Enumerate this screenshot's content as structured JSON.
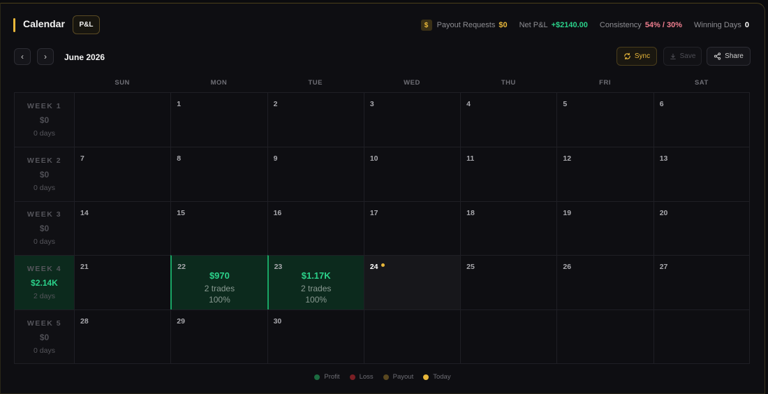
{
  "header": {
    "title": "Calendar",
    "pl_button": "P&L",
    "payout_icon": "$",
    "stats": [
      {
        "label": "Payout Requests",
        "value": "$0",
        "color": "#e8b73a"
      },
      {
        "label": "Net P&L",
        "value": "+$2140.00",
        "color": "#2bd18a"
      },
      {
        "label": "Consistency",
        "value": "54% / 30%",
        "color": "#f07f8f"
      },
      {
        "label": "Winning Days",
        "value": "0",
        "color": "#ffffff"
      }
    ]
  },
  "toolbar": {
    "prev_icon": "‹",
    "next_icon": "›",
    "month": "June 2026",
    "sync_label": "Sync",
    "save_label": "Save",
    "share_label": "Share"
  },
  "weekdays": [
    "SUN",
    "MON",
    "TUE",
    "WED",
    "THU",
    "FRI",
    "SAT"
  ],
  "weeks": [
    {
      "label": "WEEK 1",
      "amount": "$0",
      "days": "0 days",
      "active": false,
      "cells": [
        {
          "day": ""
        },
        {
          "day": "1"
        },
        {
          "day": "2"
        },
        {
          "day": "3"
        },
        {
          "day": "4"
        },
        {
          "day": "5"
        },
        {
          "day": "6"
        }
      ]
    },
    {
      "label": "WEEK 2",
      "amount": "$0",
      "days": "0 days",
      "active": false,
      "cells": [
        {
          "day": "7"
        },
        {
          "day": "8"
        },
        {
          "day": "9"
        },
        {
          "day": "10"
        },
        {
          "day": "11"
        },
        {
          "day": "12"
        },
        {
          "day": "13"
        }
      ]
    },
    {
      "label": "WEEK 3",
      "amount": "$0",
      "days": "0 days",
      "active": false,
      "cells": [
        {
          "day": "14"
        },
        {
          "day": "15"
        },
        {
          "day": "16"
        },
        {
          "day": "17"
        },
        {
          "day": "18"
        },
        {
          "day": "19"
        },
        {
          "day": "20"
        }
      ]
    },
    {
      "label": "WEEK 4",
      "amount": "$2.14K",
      "days": "2 days",
      "active": true,
      "cells": [
        {
          "day": "21"
        },
        {
          "day": "22",
          "amount": "$970",
          "trades": "2 trades",
          "pct": "100%",
          "status": "profit"
        },
        {
          "day": "23",
          "amount": "$1.17K",
          "trades": "2 trades",
          "pct": "100%",
          "status": "profit"
        },
        {
          "day": "24",
          "status": "today"
        },
        {
          "day": "25"
        },
        {
          "day": "26"
        },
        {
          "day": "27"
        }
      ]
    },
    {
      "label": "WEEK 5",
      "amount": "$0",
      "days": "0 days",
      "active": false,
      "cells": [
        {
          "day": "28"
        },
        {
          "day": "29"
        },
        {
          "day": "30"
        },
        {
          "day": ""
        },
        {
          "day": ""
        },
        {
          "day": ""
        },
        {
          "day": ""
        }
      ]
    }
  ],
  "legend": [
    {
      "label": "Profit",
      "color": "#1c6b40"
    },
    {
      "label": "Loss",
      "color": "#7a1f24"
    },
    {
      "label": "Payout",
      "color": "#5a4820"
    },
    {
      "label": "Today",
      "color": "#e8b73a"
    }
  ]
}
